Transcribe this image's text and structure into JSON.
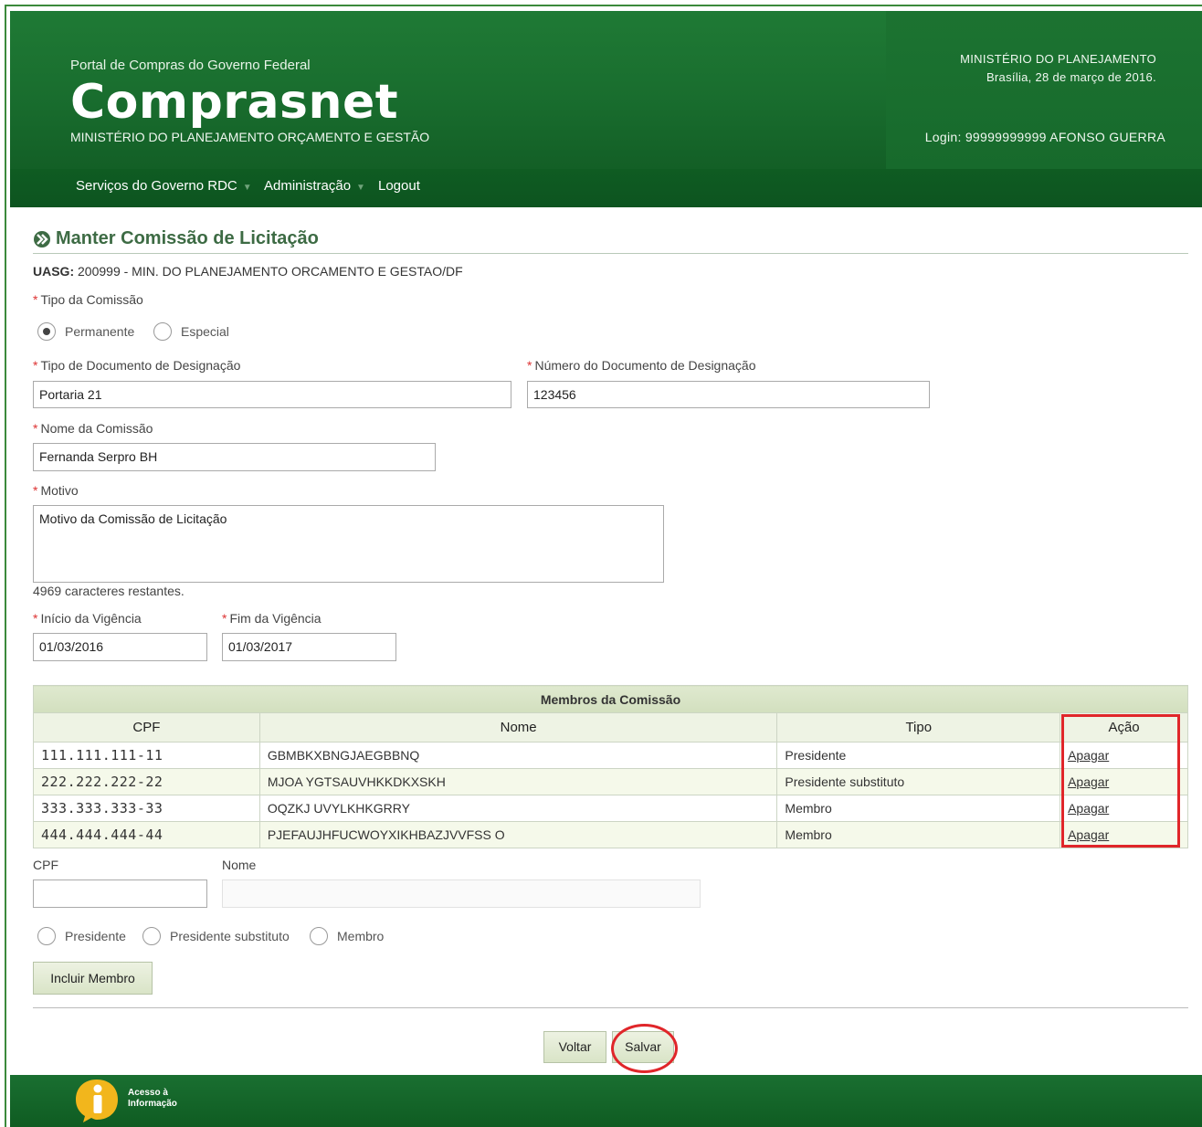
{
  "header": {
    "portal": "Portal de Compras do Governo Federal",
    "brand": "Comprasnet",
    "ministry": "MINISTÉRIO DO PLANEJAMENTO ORÇAMENTO E GESTÃO",
    "right_ministry": "MINISTÉRIO DO PLANEJAMENTO",
    "date": "Brasília, 28 de março de 2016.",
    "login": "Login: 99999999999 AFONSO GUERRA"
  },
  "nav": {
    "items": [
      {
        "label": "Serviços do Governo RDC"
      },
      {
        "label": "Administração"
      },
      {
        "label": "Logout"
      }
    ]
  },
  "page": {
    "title": "Manter Comissão de Licitação",
    "uasg_label": "UASG:",
    "uasg_value": "200999 - MIN. DO PLANEJAMENTO ORCAMENTO E GESTAO/DF"
  },
  "form": {
    "tipo_comissao_label": "Tipo da Comissão",
    "tipo_options": [
      "Permanente",
      "Especial"
    ],
    "tipo_doc_label": "Tipo de Documento de Designação",
    "tipo_doc_value": "Portaria 21",
    "num_doc_label": "Número do Documento de Designação",
    "num_doc_value": "123456",
    "nome_label": "Nome da Comissão",
    "nome_value": "Fernanda Serpro BH",
    "motivo_label": "Motivo",
    "motivo_value": "Motivo da Comissão de Licitação",
    "chars_remaining": "4969 caracteres restantes.",
    "inicio_label": "Início da Vigência",
    "inicio_value": "01/03/2016",
    "fim_label": "Fim da Vigência",
    "fim_value": "01/03/2017"
  },
  "members": {
    "caption": "Membros da Comissão",
    "headers": [
      "CPF",
      "Nome",
      "Tipo",
      "Ação"
    ],
    "rows": [
      {
        "cpf": "111.111.111-11",
        "nome": "GBMBKXBNGJAEGBBNQ",
        "tipo": "Presidente",
        "acao": "Apagar"
      },
      {
        "cpf": "222.222.222-22",
        "nome": "MJOA YGTSAUVHKKDKXSKH",
        "tipo": "Presidente substituto",
        "acao": "Apagar"
      },
      {
        "cpf": "333.333.333-33",
        "nome": "OQZKJ UVYLKHKGRRY",
        "tipo": "Membro",
        "acao": "Apagar"
      },
      {
        "cpf": "444.444.444-44",
        "nome": "PJEFAUJHFUCWOYXIKHBAZJVVFSS O",
        "tipo": "Membro",
        "acao": "Apagar"
      }
    ]
  },
  "add_member": {
    "cpf_label": "CPF",
    "nome_label": "Nome",
    "role_options": [
      "Presidente",
      "Presidente substituto",
      "Membro"
    ],
    "include_button": "Incluir Membro"
  },
  "actions": {
    "back": "Voltar",
    "save": "Salvar"
  },
  "footer": {
    "acesso_line1": "Acesso à",
    "acesso_line2": "Informação"
  },
  "colors": {
    "header_green": "#1a7030",
    "nav_green": "#0f5c22",
    "title_green": "#3d6b44",
    "highlight_red": "#e0262a"
  }
}
